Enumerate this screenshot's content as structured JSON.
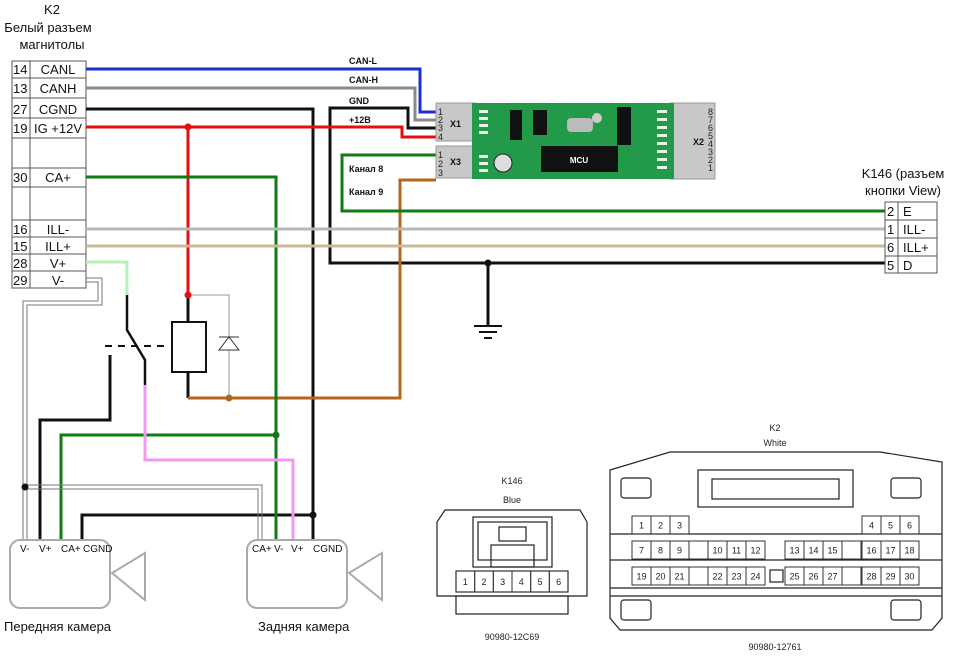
{
  "k2": {
    "title": "K2",
    "subtitle_line1": "Белый разъем",
    "subtitle_line2": "магнитолы",
    "pins": [
      {
        "num": "14",
        "name": "CANL"
      },
      {
        "num": "13",
        "name": "CANH"
      },
      {
        "num": "27",
        "name": "CGND"
      },
      {
        "num": "19",
        "name": "IG +12V"
      },
      {
        "num": "30",
        "name": "CA+"
      },
      {
        "num": "16",
        "name": "ILL-"
      },
      {
        "num": "15",
        "name": "ILL+"
      },
      {
        "num": "28",
        "name": "V+"
      },
      {
        "num": "29",
        "name": "V-"
      }
    ]
  },
  "module": {
    "wire_labels": [
      "CAN-L",
      "CAN-H",
      "GND",
      "+12В",
      "Канал 8",
      "Канал 9"
    ],
    "x1": "X1",
    "x2": "X2",
    "x3": "X3",
    "mcu": "MCU",
    "x1_pins": [
      "1",
      "2",
      "3",
      "4"
    ],
    "x3_pins": [
      "1",
      "2",
      "3"
    ],
    "x2_pins": [
      "8",
      "7",
      "6",
      "5",
      "4",
      "3",
      "2",
      "1"
    ]
  },
  "k146": {
    "title_line1": "K146 (разъем",
    "title_line2": "кнопки View)",
    "pins": [
      {
        "num": "2",
        "name": "E"
      },
      {
        "num": "1",
        "name": "ILL-"
      },
      {
        "num": "6",
        "name": "ILL+"
      },
      {
        "num": "5",
        "name": "D"
      }
    ]
  },
  "front_camera": {
    "label": "Передняя камера",
    "pins": [
      "V-",
      "V+",
      "CA+",
      "CGND"
    ]
  },
  "rear_camera": {
    "label": "Задняя камера",
    "pins": [
      "CA+",
      "V-",
      "V+",
      "CGND"
    ]
  },
  "k146_connector": {
    "title": "K146",
    "color": "Blue",
    "part": "90980-12C69",
    "pins": [
      "1",
      "2",
      "3",
      "4",
      "5",
      "6"
    ]
  },
  "k2_connector": {
    "title": "K2",
    "color": "White",
    "part": "90980-12761",
    "row1": [
      "1",
      "2",
      "3",
      "",
      "",
      "",
      "",
      "",
      "",
      "",
      "",
      "",
      "4",
      "5",
      "6"
    ],
    "row2": [
      "7",
      "8",
      "9",
      "",
      "10",
      "11",
      "12",
      "",
      "13",
      "14",
      "15",
      "",
      "16",
      "17",
      "18"
    ],
    "row3": [
      "19",
      "20",
      "21",
      "",
      "22",
      "23",
      "24",
      "",
      "25",
      "26",
      "27",
      "",
      "28",
      "29",
      "30"
    ]
  },
  "wire_colors": {
    "can_l": "#1a2fd0",
    "can_h": "#8a8a8a",
    "gnd": "#111111",
    "plus12": "#e01010",
    "ca_plus": "#127a12",
    "ill_minus": "#b8b8b8",
    "ill_plus": "#cbb89a",
    "v_plus": "#b8f0b8",
    "switched": "#f09af0",
    "channel9": "#b5651d"
  }
}
